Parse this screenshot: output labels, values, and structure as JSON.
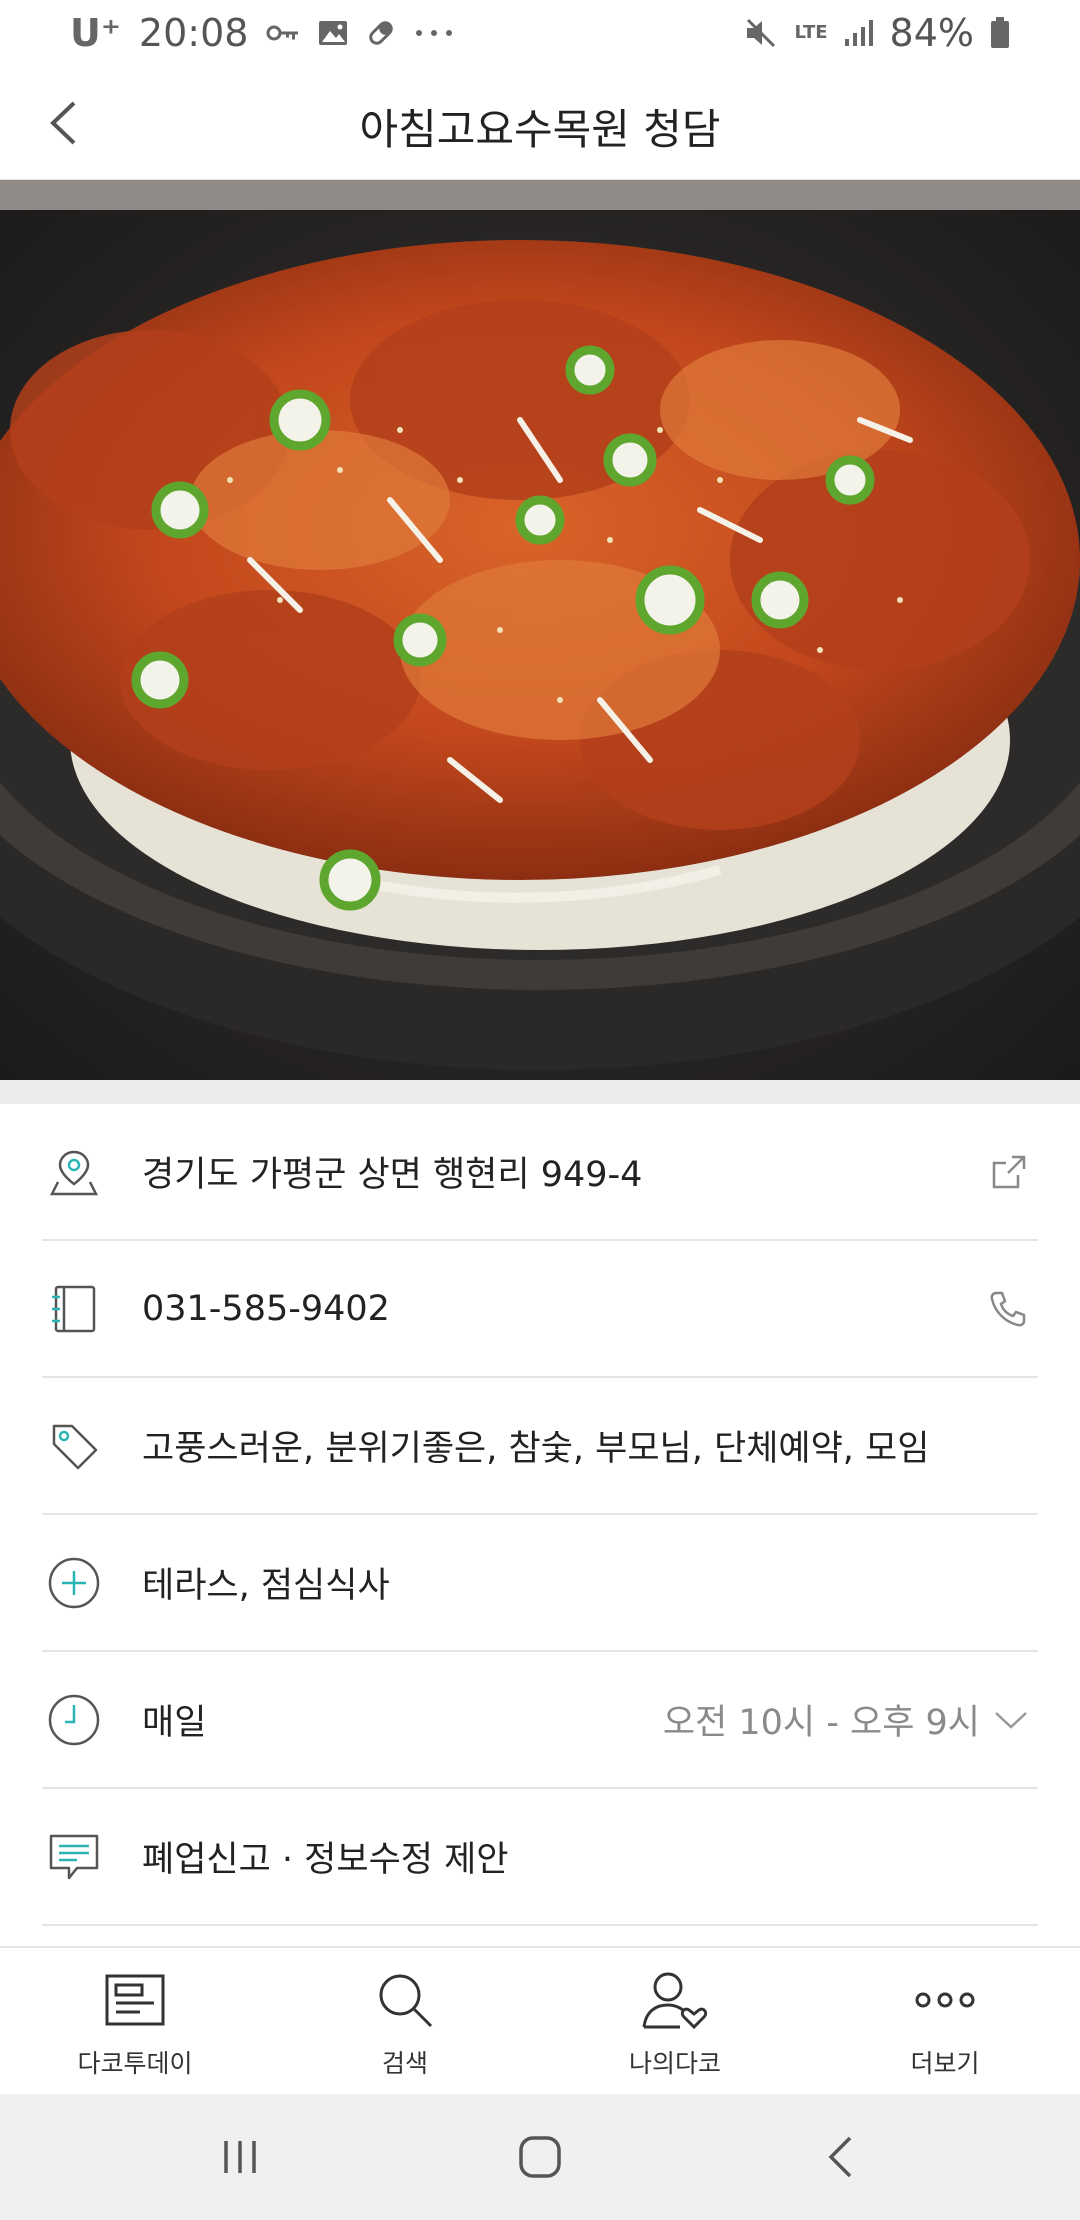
{
  "status_bar": {
    "carrier": "U⁺",
    "time": "20:08",
    "notification_icons": [
      "key-icon",
      "image-icon",
      "pill-icon",
      "more-dots-icon"
    ],
    "network": "LTE",
    "battery": "84%"
  },
  "header": {
    "title": "아침고요수목원 청담",
    "back_icon": "chevron-left-icon"
  },
  "hero_image": {
    "description_icon": "food-photo"
  },
  "info": {
    "address": "경기도 가평군 상면 행현리 949-4",
    "phone": "031-585-9402",
    "tags": "고풍스러운, 분위기좋은, 참숯, 부모님, 단체예약, 모임",
    "features": "테라스, 점심식사",
    "hours_day": "매일",
    "hours_time": "오전 10시 - 오후 9시",
    "report": "폐업신고 · 정보수정 제안"
  },
  "bottom_nav": {
    "items": [
      {
        "label": "다코투데이",
        "icon": "news-icon"
      },
      {
        "label": "검색",
        "icon": "search-icon"
      },
      {
        "label": "나의다코",
        "icon": "profile-heart-icon"
      },
      {
        "label": "더보기",
        "icon": "more-icon"
      }
    ]
  },
  "colors": {
    "accent": "#2ab5b5",
    "divider": "#e5e5e5",
    "muted_text": "#8a8a8a"
  }
}
